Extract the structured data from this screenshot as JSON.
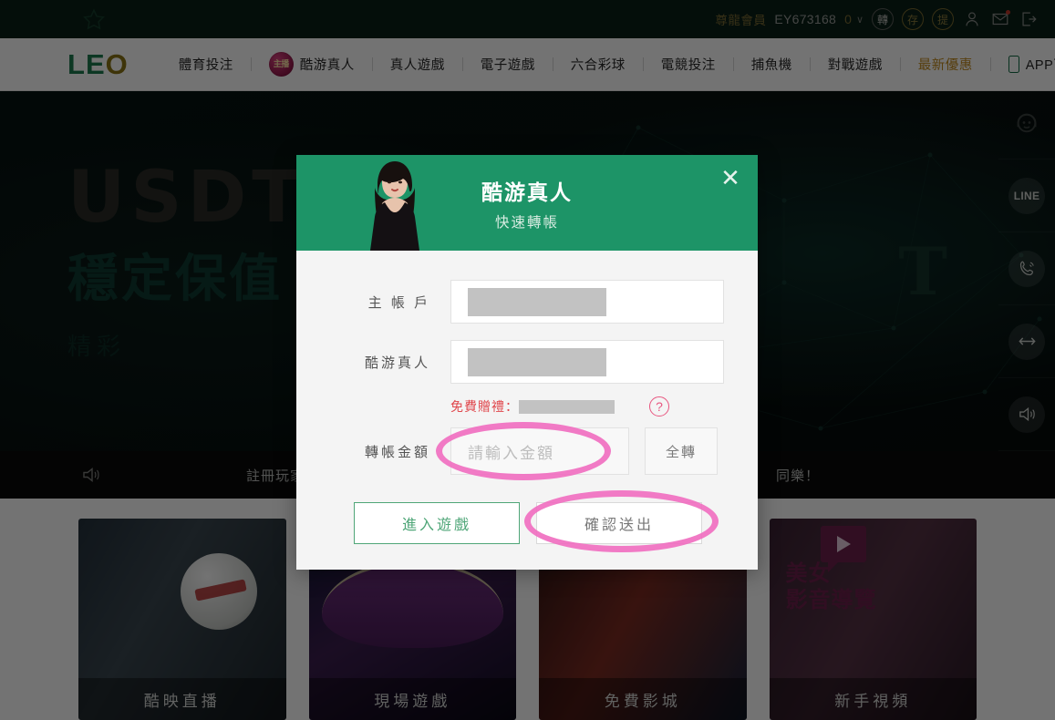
{
  "topbar": {
    "star_icon": "star-icon",
    "vip_label": "尊龍會員",
    "account": "EY673168",
    "balance": "0",
    "caret": "∨",
    "buttons": [
      {
        "name": "transfer",
        "label": "轉",
        "style": "gray"
      },
      {
        "name": "deposit",
        "label": "存",
        "style": "gold"
      },
      {
        "name": "withdraw",
        "label": "提",
        "style": "gold"
      }
    ],
    "icons": [
      "user-icon",
      "mail-icon",
      "logout-icon"
    ]
  },
  "nav": {
    "logo": {
      "part1": "L",
      "part2": "E",
      "part3": "O"
    },
    "items": [
      {
        "label": "體育投注",
        "badge": null,
        "hot": false
      },
      {
        "label": "酷游真人",
        "badge": "主播",
        "hot": false
      },
      {
        "label": "真人遊戲",
        "badge": null,
        "hot": false
      },
      {
        "label": "電子遊戲",
        "badge": null,
        "hot": false
      },
      {
        "label": "六合彩球",
        "badge": null,
        "hot": false
      },
      {
        "label": "電競投注",
        "badge": null,
        "hot": false
      },
      {
        "label": "捕魚機",
        "badge": null,
        "hot": false
      },
      {
        "label": "對戰遊戲",
        "badge": null,
        "hot": false
      },
      {
        "label": "最新優惠",
        "badge": null,
        "hot": true
      },
      {
        "label": "APP下載",
        "badge": null,
        "hot": false,
        "icon": "mobile-phone-icon"
      }
    ]
  },
  "hero": {
    "title": "USDT",
    "subtitle": "穩定保值",
    "subtitle2": "精彩",
    "mark": "T"
  },
  "dock": {
    "items": [
      {
        "name": "customer-service",
        "label": "",
        "icon": "headset-icon"
      },
      {
        "name": "line",
        "label": "LINE",
        "icon": "line-icon"
      },
      {
        "name": "phone",
        "label": "",
        "icon": "phone-icon"
      },
      {
        "name": "transfer",
        "label": "",
        "icon": "transfer-arrows-icon"
      },
      {
        "name": "sound",
        "label": "",
        "icon": "speaker-icon"
      }
    ]
  },
  "marquee": {
    "icon": "speaker-icon",
    "text_left": "註冊玩家起",
    "text_right": "同樂！"
  },
  "cards": [
    {
      "label": "酷映直播"
    },
    {
      "label": "現場遊戲"
    },
    {
      "label": "免費影城"
    },
    {
      "label": "新手視頻",
      "promo_line1": "美女",
      "promo_line2": "影音導覽"
    }
  ],
  "modal": {
    "title": "酷游真人",
    "subtitle": "快速轉帳",
    "close_label": "✕",
    "fields": [
      {
        "label": "主 帳 戶",
        "value": "",
        "redacted": true
      },
      {
        "label": "酷游真人",
        "value": "",
        "redacted": true
      }
    ],
    "gift": {
      "label": "免費贈禮：",
      "value": "",
      "redacted": true,
      "help_icon": "?"
    },
    "amount": {
      "label": "轉帳金額",
      "placeholder": "請輸入金額",
      "value": "",
      "all_button": "全轉"
    },
    "buttons": [
      {
        "name": "enter-game",
        "label": "進入遊戲",
        "style": "enter"
      },
      {
        "name": "confirm-submit",
        "label": "確認送出",
        "style": "confirm"
      }
    ]
  },
  "annotations": {
    "color": "#f06fc0",
    "marks": [
      "amount-input-highlight",
      "confirm-button-highlight"
    ]
  },
  "colors": {
    "brand_green": "#1d9467",
    "topbar_bg": "#0b2017",
    "gold": "#8c7c3c",
    "red": "#e0474c",
    "pink": "#f06fc0"
  }
}
